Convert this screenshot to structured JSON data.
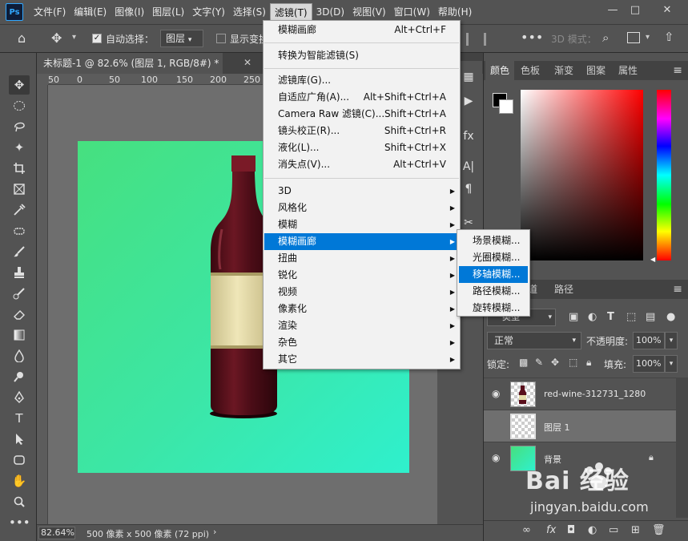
{
  "menubar": {
    "logo": "Ps",
    "items": [
      "文件(F)",
      "编辑(E)",
      "图像(I)",
      "图层(L)",
      "文字(Y)",
      "选择(S)",
      "滤镜(T)",
      "3D(D)",
      "视图(V)",
      "窗口(W)",
      "帮助(H)"
    ],
    "active_index": 6,
    "window_controls": [
      "—",
      "□",
      "✕"
    ]
  },
  "options": {
    "auto_select_label": "自动选择：",
    "layer_select": "图层",
    "show_transform_label": "显示变换",
    "mode_3d_label": "3D 模式："
  },
  "document": {
    "tab_title": "未标题-1 @ 82.6% (图层 1, RGB/8#) *",
    "close": "✕",
    "ruler_marks": [
      "50",
      "0",
      "50",
      "100",
      "150",
      "200",
      "250"
    ]
  },
  "status": {
    "zoom": "82.64%",
    "size": "500 像素 x 500 像素 (72 ppi)",
    "arrow": "›"
  },
  "filter_menu": {
    "group1": [
      {
        "label": "模糊画廊",
        "shortcut": "Alt+Ctrl+F"
      }
    ],
    "group2": [
      {
        "label": "转换为智能滤镜(S)",
        "shortcut": ""
      }
    ],
    "group3": [
      {
        "label": "滤镜库(G)...",
        "shortcut": ""
      },
      {
        "label": "自适应广角(A)...",
        "shortcut": "Alt+Shift+Ctrl+A"
      },
      {
        "label": "Camera Raw 滤镜(C)...",
        "shortcut": "Shift+Ctrl+A"
      },
      {
        "label": "镜头校正(R)...",
        "shortcut": "Shift+Ctrl+R"
      },
      {
        "label": "液化(L)...",
        "shortcut": "Shift+Ctrl+X"
      },
      {
        "label": "消失点(V)...",
        "shortcut": "Alt+Ctrl+V"
      }
    ],
    "group4": [
      "3D",
      "风格化",
      "模糊",
      "模糊画廊",
      "扭曲",
      "锐化",
      "视频",
      "像素化",
      "渲染",
      "杂色",
      "其它"
    ],
    "highlighted": "模糊画廊"
  },
  "blur_gallery_submenu": {
    "items": [
      "场景模糊...",
      "光圈模糊...",
      "移轴模糊...",
      "路径模糊...",
      "旋转模糊..."
    ],
    "highlighted": "移轴模糊..."
  },
  "color_panel": {
    "tabs": [
      "颜色",
      "色板",
      "渐变",
      "图案",
      "属性"
    ],
    "active_tab": "颜色",
    "foreground": "#000000",
    "background": "#ffffff"
  },
  "layers_panel": {
    "tabs": [
      "道",
      "路径"
    ],
    "kind": "类型",
    "blend_mode": "正常",
    "opacity_label": "不透明度:",
    "opacity": "100%",
    "lock_label": "锁定:",
    "fill_label": "填充:",
    "fill": "100%",
    "layers": [
      {
        "name": "red-wine-312731_1280",
        "selected": false
      },
      {
        "name": "图层 1",
        "selected": true
      },
      {
        "name": "背景",
        "selected": false
      }
    ]
  },
  "watermark": {
    "brand": "Bai  经验",
    "url": "jingyan.baidu.com"
  },
  "colors": {
    "accent": "#0078d7",
    "canvas_start": "#46e07f",
    "canvas_end": "#2ff0cd",
    "wine": "#5a0f1c"
  }
}
